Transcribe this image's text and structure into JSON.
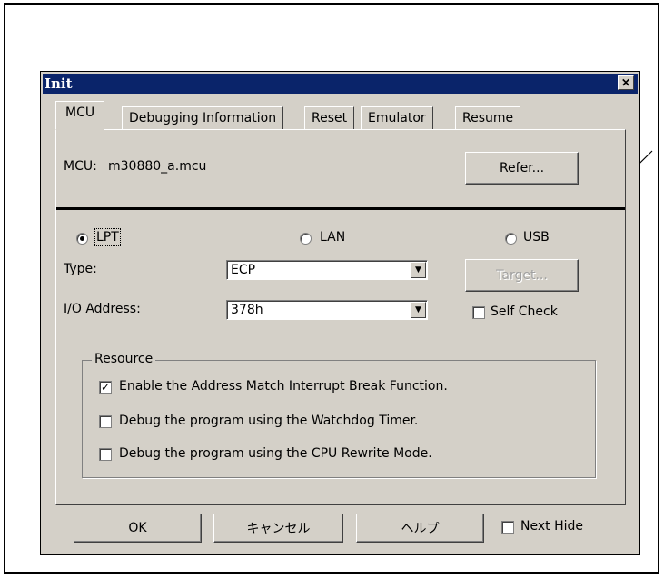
{
  "window": {
    "title": "Init",
    "close_glyph": "✕"
  },
  "tabs": [
    {
      "label": "MCU",
      "active": true
    },
    {
      "label": "Debugging Information"
    },
    {
      "label": "Reset"
    },
    {
      "label": "Emulator"
    },
    {
      "label": "Resume"
    }
  ],
  "mcu": {
    "label": "MCU:",
    "file": "m30880_a.mcu",
    "refer_button": "Refer..."
  },
  "connection": {
    "options": [
      {
        "label": "LPT",
        "selected": true
      },
      {
        "label": "LAN",
        "selected": false
      },
      {
        "label": "USB",
        "selected": false
      }
    ]
  },
  "type": {
    "label": "Type:",
    "value": "ECP"
  },
  "io_address": {
    "label": "I/O Address:",
    "value": "378h"
  },
  "target_button": "Target...",
  "self_check": {
    "label": "Self Check",
    "checked": false
  },
  "resource": {
    "title": "Resource",
    "items": [
      {
        "label": "Enable the Address Match Interrupt Break Function.",
        "checked": true
      },
      {
        "label": "Debug the program using the Watchdog Timer.",
        "checked": false
      },
      {
        "label": "Debug the program using the CPU Rewrite Mode.",
        "checked": false
      }
    ]
  },
  "footer": {
    "ok": "OK",
    "cancel": "キャンセル",
    "help": "ヘルプ",
    "next_hide": "Next Hide",
    "next_hide_checked": false
  },
  "check_glyph": "✓",
  "dropdown_glyph": "▼",
  "colors": {
    "titlebar": "#0a246a",
    "face": "#d4d0c8"
  }
}
